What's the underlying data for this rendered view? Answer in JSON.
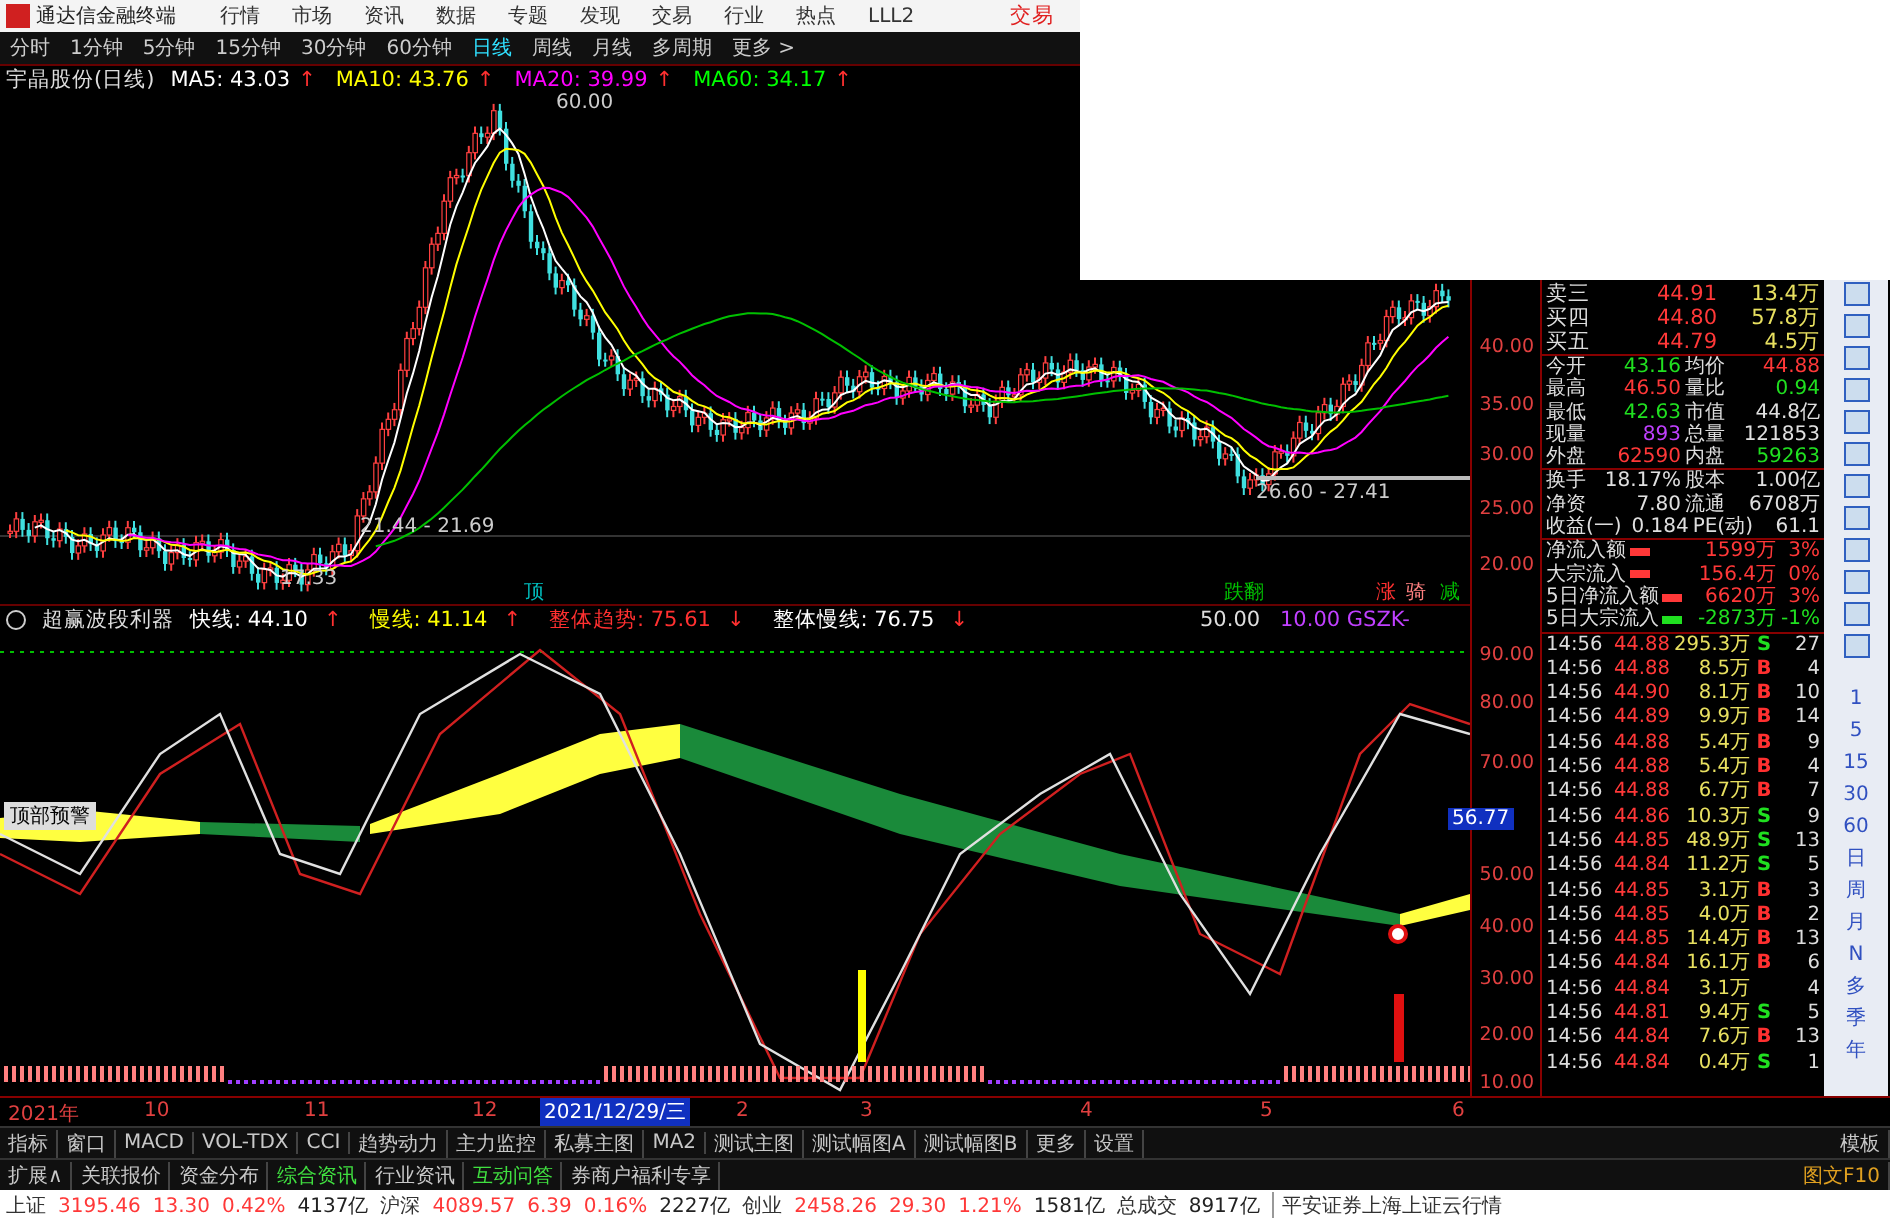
{
  "menu_bar": {
    "app_title": "通达信金融终端",
    "items": [
      "行情",
      "市场",
      "资讯",
      "数据",
      "专题",
      "发现",
      "交易",
      "行业",
      "热点",
      "LLL2"
    ],
    "trade_link": "交易"
  },
  "periods": [
    {
      "label": "分时",
      "selected": false
    },
    {
      "label": "1分钟",
      "selected": false
    },
    {
      "label": "5分钟",
      "selected": false
    },
    {
      "label": "15分钟",
      "selected": false
    },
    {
      "label": "30分钟",
      "selected": false
    },
    {
      "label": "60分钟",
      "selected": false
    },
    {
      "label": "日线",
      "selected": true
    },
    {
      "label": "周线",
      "selected": false
    },
    {
      "label": "月线",
      "selected": false
    },
    {
      "label": "多周期",
      "selected": false
    },
    {
      "label": "更多 >",
      "selected": false
    }
  ],
  "ma_line": {
    "stock": "宇晶股份(日线)",
    "values": [
      {
        "label": "MA5: 43.03",
        "arrow": "↑",
        "color": "#ffffff"
      },
      {
        "label": "MA10: 43.76",
        "arrow": "↑",
        "color": "#ffff00"
      },
      {
        "label": "MA20: 39.99",
        "arrow": "↑",
        "color": "#ff00ff"
      },
      {
        "label": "MA60: 34.17",
        "arrow": "↑",
        "color": "#00ff00"
      }
    ]
  },
  "main_chart": {
    "y_axis": [
      "40.00",
      "35.00",
      "30.00",
      "25.00",
      "20.00"
    ],
    "annotations": [
      {
        "text": "60.00"
      },
      {
        "text": "21.44 - 21.69"
      },
      {
        "text": "17.33"
      },
      {
        "text": "26.60 - 27.41"
      }
    ]
  },
  "indicator": {
    "name": "超赢波段利器",
    "values": [
      {
        "label": "快线: 44.10",
        "arrow": "↑",
        "color": "#ffffff"
      },
      {
        "label": "慢线: 41.14",
        "arrow": "↑",
        "color": "#ffff00"
      },
      {
        "label": "整体趋势: 75.61",
        "arrow": "↓",
        "color": "#ff3030"
      },
      {
        "label": "整体慢线: 76.75",
        "arrow": "↓",
        "color": "#ffffff"
      }
    ],
    "signals": [
      {
        "text": "顶",
        "color": "#00c0c0"
      },
      {
        "text": "跌翻",
        "color": "#00c000"
      },
      {
        "text": "涨",
        "color": "#ff3030"
      },
      {
        "text": "骑",
        "color": "#ff8080"
      },
      {
        "text": "减",
        "color": "#00c000"
      }
    ],
    "extra": [
      "50.00",
      "10.00 GSZK-"
    ],
    "warning_label": "顶部预警",
    "y_axis": [
      "90.00",
      "80.00",
      "70.00",
      "50.00",
      "40.00",
      "30.00",
      "20.00",
      "10.00"
    ],
    "current_value": "56.77"
  },
  "quote": {
    "order_book": [
      {
        "name": "卖三",
        "price": "44.91",
        "volume": "13.4万"
      },
      {
        "name": "买四",
        "price": "44.80",
        "volume": "57.8万"
      },
      {
        "name": "买五",
        "price": "44.79",
        "volume": "4.5万"
      }
    ],
    "stats": [
      {
        "cells": [
          {
            "label": "今开",
            "value": "43.16",
            "color": "#20e020"
          },
          {
            "label": "均价",
            "value": "44.88",
            "color": "#ff3838"
          }
        ]
      },
      {
        "cells": [
          {
            "label": "最高",
            "value": "46.50",
            "color": "#ff3838"
          },
          {
            "label": "量比",
            "value": "0.94",
            "color": "#20e020"
          }
        ]
      },
      {
        "cells": [
          {
            "label": "最低",
            "value": "42.63",
            "color": "#20e020"
          },
          {
            "label": "市值",
            "value": "44.8亿",
            "color": "#e0e0e0"
          }
        ]
      },
      {
        "cells": [
          {
            "label": "现量",
            "value": "893",
            "color": "#c040ff"
          },
          {
            "label": "总量",
            "value": "121853",
            "color": "#e0e0e0"
          }
        ]
      },
      {
        "cells": [
          {
            "label": "外盘",
            "value": "62590",
            "color": "#ff3838"
          },
          {
            "label": "内盘",
            "value": "59263",
            "color": "#20e020"
          }
        ]
      },
      {
        "cells": [
          {
            "label": "换手",
            "value": "18.17%",
            "color": "#e0e0e0"
          },
          {
            "label": "股本",
            "value": "1.00亿",
            "color": "#e0e0e0"
          }
        ]
      },
      {
        "cells": [
          {
            "label": "净资",
            "value": "7.80",
            "color": "#e0e0e0"
          },
          {
            "label": "流通",
            "value": "6708万",
            "color": "#e0e0e0"
          }
        ]
      },
      {
        "cells": [
          {
            "label": "收益(一)",
            "value": "0.184",
            "color": "#e0e0e0"
          },
          {
            "label": "PE(动)",
            "value": "61.1",
            "color": "#e0e0e0"
          }
        ]
      }
    ],
    "flows": [
      {
        "label": "净流入额",
        "amount": "1599万",
        "percent": "3%",
        "color": "#ff3838"
      },
      {
        "label": "大宗流入",
        "amount": "156.4万",
        "percent": "0%",
        "color": "#ff3838"
      },
      {
        "label": "5日净流入额",
        "amount": "6620万",
        "percent": "3%",
        "color": "#ff3838"
      },
      {
        "label": "5日大宗流入",
        "amount": "-2873万",
        "percent": "-1%",
        "color": "#20e020"
      }
    ],
    "ticks": [
      {
        "time": "14:56",
        "price": "44.88",
        "volume": "295.3万",
        "side": "S",
        "kind": "sell",
        "count": "27"
      },
      {
        "time": "14:56",
        "price": "44.88",
        "volume": "8.5万",
        "side": "B",
        "kind": "buy",
        "count": "4"
      },
      {
        "time": "14:56",
        "price": "44.90",
        "volume": "8.1万",
        "side": "B",
        "kind": "buy",
        "count": "10"
      },
      {
        "time": "14:56",
        "price": "44.89",
        "volume": "9.9万",
        "side": "B",
        "kind": "buy",
        "count": "14"
      },
      {
        "time": "14:56",
        "price": "44.88",
        "volume": "5.4万",
        "side": "B",
        "kind": "buy",
        "count": "9"
      },
      {
        "time": "14:56",
        "price": "44.88",
        "volume": "5.4万",
        "side": "B",
        "kind": "buy",
        "count": "4"
      },
      {
        "time": "14:56",
        "price": "44.88",
        "volume": "6.7万",
        "side": "B",
        "kind": "buy",
        "count": "7"
      },
      {
        "time": "14:56",
        "price": "44.86",
        "volume": "10.3万",
        "side": "S",
        "kind": "sell",
        "count": "9"
      },
      {
        "time": "14:56",
        "price": "44.85",
        "volume": "48.9万",
        "side": "S",
        "kind": "sell",
        "count": "13"
      },
      {
        "time": "14:56",
        "price": "44.84",
        "volume": "11.2万",
        "side": "S",
        "kind": "sell",
        "count": "5"
      },
      {
        "time": "14:56",
        "price": "44.85",
        "volume": "3.1万",
        "side": "B",
        "kind": "buy",
        "count": "3"
      },
      {
        "time": "14:56",
        "price": "44.85",
        "volume": "4.0万",
        "side": "B",
        "kind": "buy",
        "count": "2"
      },
      {
        "time": "14:56",
        "price": "44.85",
        "volume": "14.4万",
        "side": "B",
        "kind": "buy",
        "count": "13"
      },
      {
        "time": "14:56",
        "price": "44.84",
        "volume": "16.1万",
        "side": "B",
        "kind": "buy",
        "count": "6"
      },
      {
        "time": "14:56",
        "price": "44.84",
        "volume": "3.1万",
        "kind": "none",
        "count": "4"
      },
      {
        "time": "14:56",
        "price": "44.81",
        "volume": "9.4万",
        "side": "S",
        "kind": "sell",
        "count": "5"
      },
      {
        "time": "14:56",
        "price": "44.84",
        "volume": "7.6万",
        "side": "B",
        "kind": "buy",
        "count": "13"
      },
      {
        "time": "14:56",
        "price": "44.84",
        "volume": "0.4万",
        "side": "S",
        "kind": "sell",
        "count": "1"
      }
    ]
  },
  "toolbar": {
    "periods": [
      "1",
      "5",
      "15",
      "30",
      "60",
      "日",
      "周",
      "月",
      "N",
      "多",
      "季",
      "年"
    ]
  },
  "date_axis": {
    "labels": [
      "2021年",
      "10",
      "11",
      "12",
      "2",
      "3",
      "4",
      "5",
      "6"
    ],
    "cursor_date": "2021/12/29/三"
  },
  "tabs": [
    "指标",
    "窗口",
    "MACD",
    "VOL-TDX",
    "CCI",
    "趋势动力",
    "主力监控",
    "私募主图",
    "MA2",
    "测试主图",
    "测试幅图A",
    "测试幅图B",
    "更多",
    "设置"
  ],
  "template_label": "模板",
  "tabs2": [
    {
      "label": "扩展∧",
      "kind": "normal"
    },
    {
      "label": "关联报价",
      "kind": "normal"
    },
    {
      "label": "资金分布",
      "kind": "normal"
    },
    {
      "label": "综合资讯",
      "kind": "green"
    },
    {
      "label": "行业资讯",
      "kind": "normal"
    },
    {
      "label": "互动问答",
      "kind": "green"
    },
    {
      "label": "券商户福利专享",
      "kind": "normal"
    }
  ],
  "f10_label": "图文F10",
  "status_bar": {
    "indices": [
      {
        "name": "上证",
        "value": "3195.46",
        "change": "13.30",
        "percent": "0.42%",
        "amount": "4137亿"
      },
      {
        "name": "沪深",
        "value": "4089.57",
        "change": "6.39",
        "percent": "0.16%",
        "amount": "2227亿"
      },
      {
        "name": "创业",
        "value": "2458.26",
        "change": "29.30",
        "percent": "1.21%",
        "amount": "1581亿"
      }
    ],
    "total_label": "总成交",
    "total_amount": "8917亿",
    "broker": "平安证券上海上证云行情"
  }
}
